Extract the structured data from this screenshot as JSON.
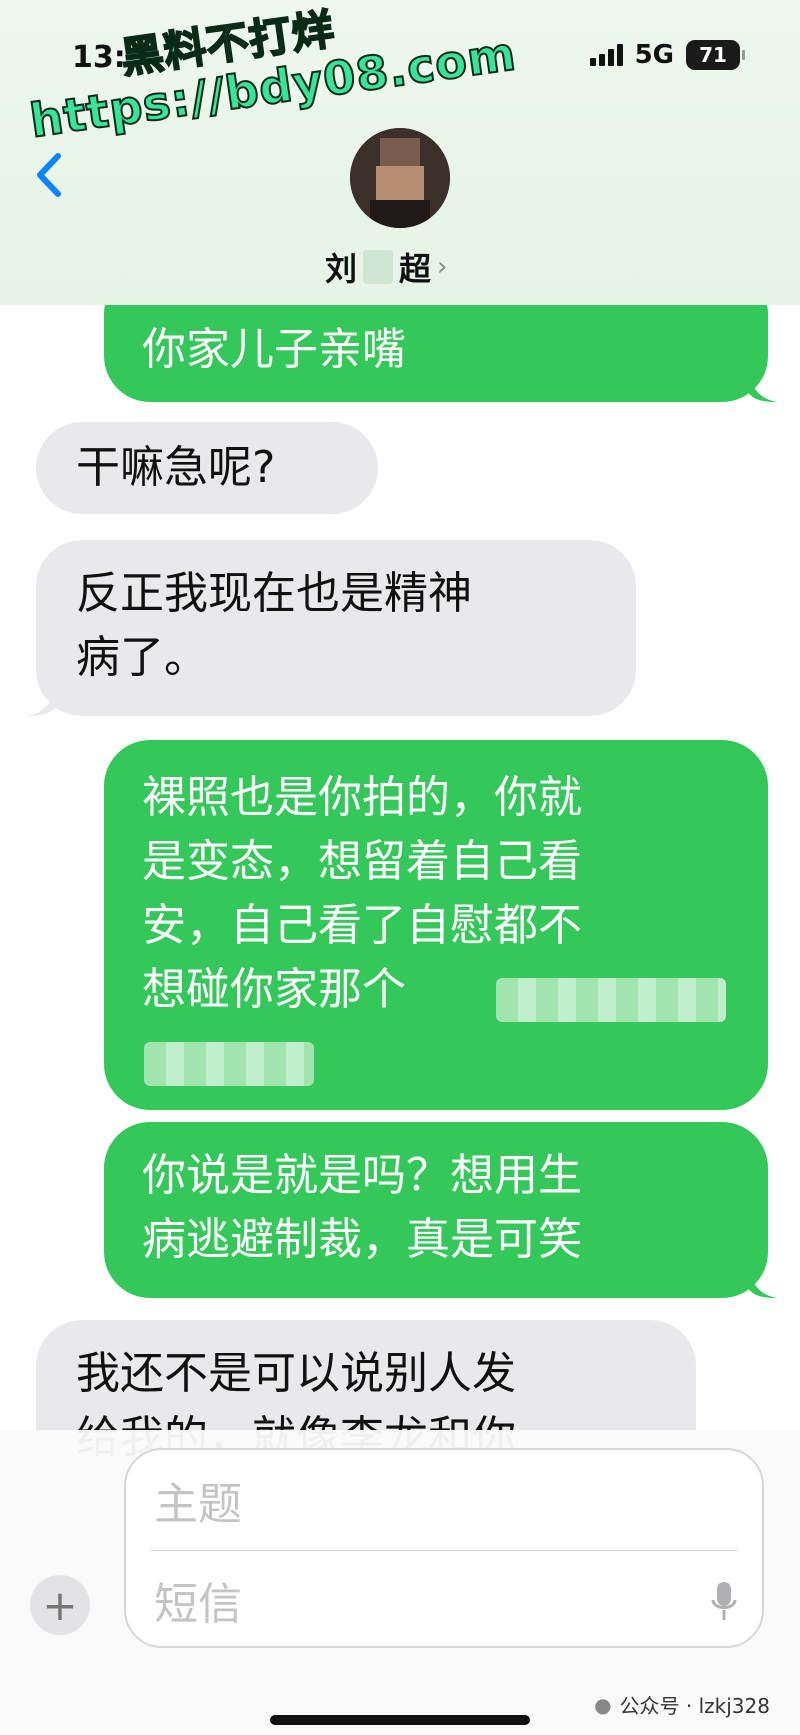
{
  "status": {
    "time": "13:",
    "network": "5G",
    "battery": "71"
  },
  "watermark": {
    "line1": "黑料不打烊",
    "line2": "https://bdy08.com"
  },
  "contact": {
    "name_first": "刘",
    "name_last": "超"
  },
  "messages": [
    {
      "type": "sent",
      "text": "你家儿子亲嘴"
    },
    {
      "type": "received",
      "text": "干嘛急呢?"
    },
    {
      "type": "received",
      "text": "反正我现在也是精神\n病了。"
    },
    {
      "type": "sent",
      "text": "裸照也是你拍的，你就\n是变态，想留着自己看\n安，自己看了自慰都不\n想碰你家那个"
    },
    {
      "type": "sent",
      "text": "你说是就是吗？想用生\n病逃避制裁，真是可笑"
    },
    {
      "type": "received",
      "text": "我还不是可以说别人发\n给我的，就像李龙和你"
    }
  ],
  "compose": {
    "subject_placeholder": "主题",
    "message_placeholder": "短信"
  },
  "credit": "公众号 · lzkj328",
  "colors": {
    "sent": "#34c759",
    "received": "#e9e9eb",
    "accent": "#0a84ff"
  }
}
